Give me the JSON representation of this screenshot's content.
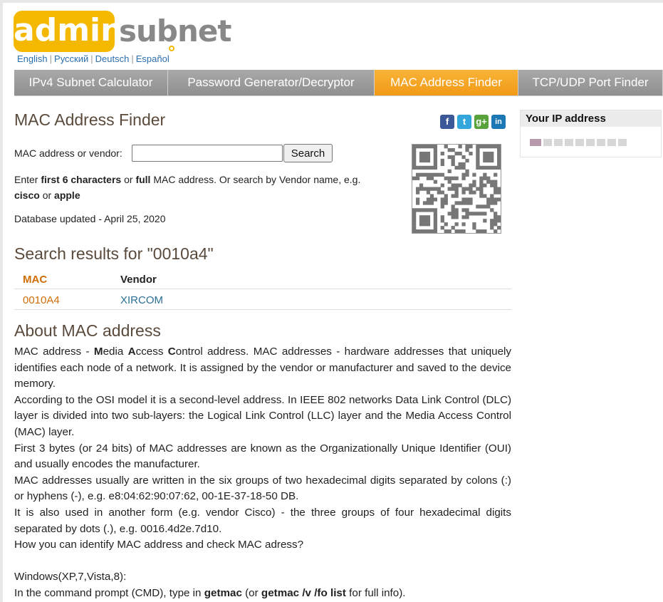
{
  "logo": {
    "part1": "admin",
    "part2": "subnet"
  },
  "languages": [
    "English",
    "Русский",
    "Deutsch",
    "Español"
  ],
  "nav": [
    {
      "label": "IPv4 Subnet Calculator",
      "active": false
    },
    {
      "label": "Password Generator/Decryptor",
      "active": false
    },
    {
      "label": "MAC Address Finder",
      "active": true
    },
    {
      "label": "TCP/UDP Port Finder",
      "active": false
    }
  ],
  "page_title": "MAC Address Finder",
  "social": {
    "facebook": "f",
    "twitter": "t",
    "google": "g+",
    "linkedin": "in"
  },
  "search": {
    "label": "MAC address or vendor:",
    "value": "",
    "button": "Search"
  },
  "hint": {
    "p1": "Enter ",
    "b1": "first 6 characters",
    "p2": " or ",
    "b2": "full",
    "p3": " MAC address. Or search by Vendor name, e.g. ",
    "b3": "cisco",
    "p4": " or ",
    "b4": "apple"
  },
  "db_updated": "Database updated - April 25, 2020",
  "results": {
    "title": "Search results for \"0010a4\"",
    "headers": {
      "mac": "MAC",
      "vendor": "Vendor"
    },
    "rows": [
      {
        "mac": "0010A4",
        "vendor": "XIRCOM"
      }
    ]
  },
  "about": {
    "title": "About MAC address",
    "p1_a": "MAC address - ",
    "p1_m": "M",
    "p1_b": "edia ",
    "p1_A": "A",
    "p1_c": "ccess ",
    "p1_C": "C",
    "p1_d": "ontrol address. MAC addresses - hardware addresses that uniquely identifies each node of a network. It is assigned by the vendor or manufacturer and saved to the device memory.",
    "p2": "According to the OSI model it is a second-level address. In IEEE 802 networks Data Link Control (DLC) layer is divided into two sub-layers: the Logical Link Control (LLC) layer and the Media Access Control (MAC) layer.",
    "p3": "First 3 bytes (or 24 bits) of MAC addresses are known as the Organizationally Unique Identifier (OUI) and usually encodes the manufacturer.",
    "p4": "MAC addresses usually are written in the six groups of two hexadecimal digits separated by colons (:) or hyphens (-), e.g. e8:04:62:90:07:62, 00-1E-37-18-50 DB.",
    "p5": "It is also used in another form (e.g. vendor Cisco) - the three groups of four hexadecimal digits separated by dots (.), e.g. 0016.4d2e.7d10.",
    "p6": "How you can identify MAC address and check MAC adress?",
    "p7": "Windows(XP,7,Vista,8):",
    "p8_a": "In the command prompt (CMD), type in ",
    "p8_b": "getmac",
    "p8_c": " (or ",
    "p8_d": "getmac /v /fo list",
    "p8_e": " for full info)."
  },
  "ip_panel": {
    "title": "Your IP address"
  },
  "colors": {
    "accent": "#f29a16",
    "logo_yellow": "#f5b800",
    "nav_gray": "#9a9a9a",
    "link": "#2a6fb0",
    "heading": "#5a4a3c"
  }
}
